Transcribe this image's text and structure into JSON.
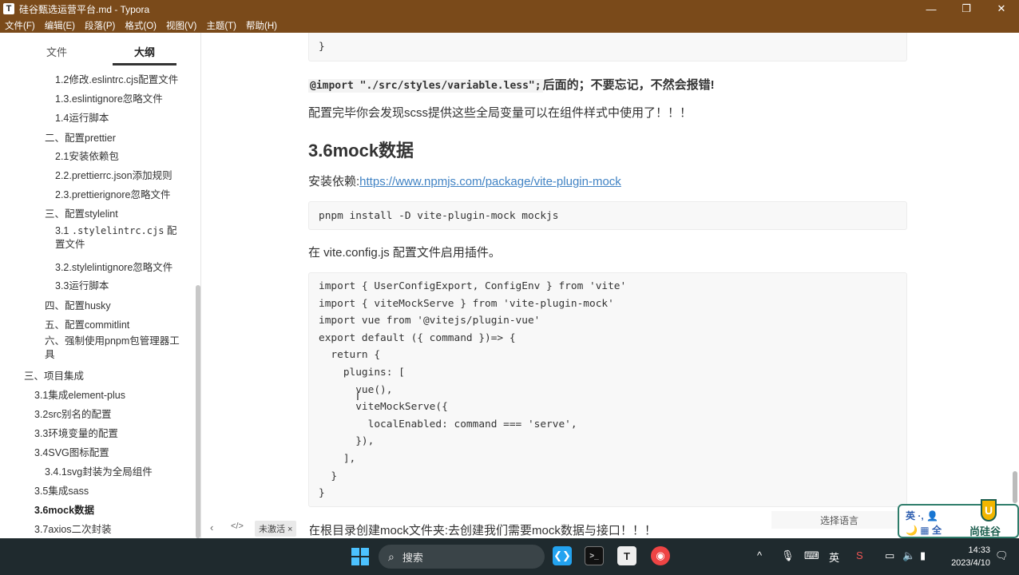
{
  "window": {
    "title": "硅谷甄选运营平台.md - Typora",
    "app_icon": "T",
    "minimize": "—",
    "maximize": "❐",
    "close": "✕"
  },
  "menu": [
    "文件(F)",
    "编辑(E)",
    "段落(P)",
    "格式(O)",
    "视图(V)",
    "主题(T)",
    "帮助(H)"
  ],
  "sidebar": {
    "tab_files": "文件",
    "tab_outline": "大纲",
    "items": [
      {
        "label": "1.2修改.eslintrc.cjs配置文件"
      },
      {
        "label": "1.3.eslintignore忽略文件"
      },
      {
        "label": "1.4运行脚本"
      },
      {
        "label": "二、配置prettier"
      },
      {
        "label": "2.1安装依赖包"
      },
      {
        "label": "2.2.prettierrc.json添加规则"
      },
      {
        "label": "2.3.prettierignore忽略文件"
      },
      {
        "label": "三、配置stylelint"
      },
      {
        "label_pre": "3.1 ",
        "label_code": ".stylelintrc.cjs",
        "label_post": " 配置文件"
      },
      {
        "label": "3.2.stylelintignore忽略文件"
      },
      {
        "label": "3.3运行脚本"
      },
      {
        "label": "四、配置husky"
      },
      {
        "label": "五、配置commitlint"
      },
      {
        "label": "六、强制使用pnpm包管理器工具"
      },
      {
        "label": "三、项目集成"
      },
      {
        "label": "3.1集成element-plus"
      },
      {
        "label": "3.2src别名的配置"
      },
      {
        "label": "3.3环境变量的配置"
      },
      {
        "label": "3.4SVG图标配置"
      },
      {
        "label": "3.4.1svg封装为全局组件"
      },
      {
        "label": "3.5集成sass"
      },
      {
        "label": "3.6mock数据"
      },
      {
        "label": "3.7axios二次封装"
      }
    ]
  },
  "editor": {
    "top_code_tail": "}",
    "import_note_code": "@import \"./src/styles/variable.less\";",
    "import_note_text": "后面的；不要忘记，不然会报错!",
    "scss_note": "配置完毕你会发现scss提供这些全局变量可以在组件样式中使用了！！！",
    "heading": "3.6mock数据",
    "install_label": "安装依赖:",
    "install_link": "https://www.npmjs.com/package/vite-plugin-mock",
    "install_cmd": "pnpm install -D vite-plugin-mock mockjs",
    "config_note": "在 vite.config.js 配置文件启用插件。",
    "config_code": "import { UserConfigExport, ConfigEnv } from 'vite'\nimport { viteMockServe } from 'vite-plugin-mock'\nimport vue from '@vitejs/plugin-vue'\nexport default ({ command })=> {\n  return {\n    plugins: [\n      vue(),\n      viteMockServe({\n        localEnabled: command === 'serve',\n      }),\n    ],\n  }\n}",
    "bottom_note": "在根目录创建mock文件夹:去创建我们需要mock数据与接口！！！",
    "language_select": "选择语言"
  },
  "statusbar": {
    "back_icon": "‹",
    "source_icon": "</>",
    "badge": "未激活 ×"
  },
  "ime": {
    "row1": "英 ·, 👤",
    "row2": "🌙 ▦ 全",
    "brand": "尚硅谷",
    "logo": "U"
  },
  "taskbar": {
    "search_label": "搜索",
    "search_icon": "⌕",
    "tray_lang": "英",
    "time": "14:33",
    "date": "2023/4/10",
    "colors": {
      "bg": "#1f2a2e",
      "accent": "#4cc2ff"
    }
  }
}
